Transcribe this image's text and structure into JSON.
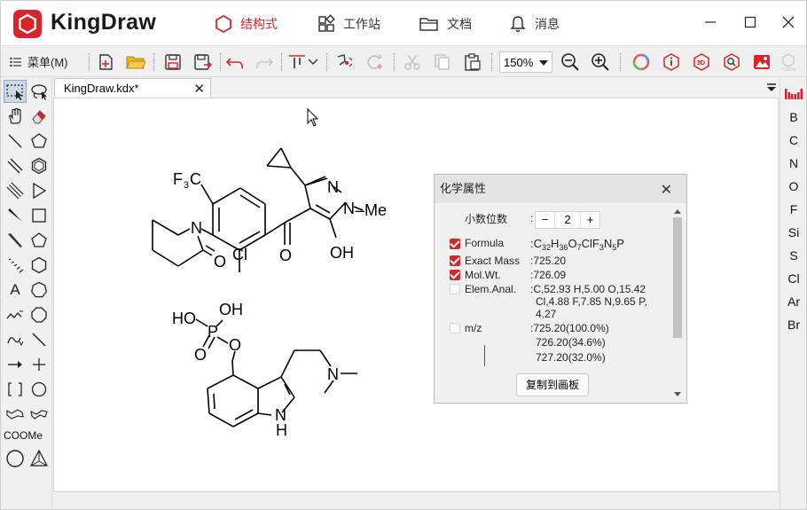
{
  "app": {
    "brand": "KingDraw"
  },
  "nav": {
    "tabs": [
      {
        "label": "结构式",
        "icon": "hexagon-icon",
        "active": true
      },
      {
        "label": "工作站",
        "icon": "grid-icon"
      },
      {
        "label": "文档",
        "icon": "folder-icon"
      },
      {
        "label": "消息",
        "icon": "bell-icon"
      }
    ]
  },
  "toolbar": {
    "menu_label": "菜单(M)",
    "zoom_value": "150%"
  },
  "document": {
    "tab_label": "KingDraw.kdx*"
  },
  "palette": {
    "text_tool": "A",
    "coome_label": "COOMe"
  },
  "elements": [
    "B",
    "C",
    "N",
    "O",
    "F",
    "Si",
    "S",
    "Cl",
    "Ar",
    "Br"
  ],
  "canvas": {
    "mol1": {
      "cf3_f": "F",
      "cf3_3": "3",
      "cf3_c": "C",
      "n_ring": "N",
      "o_ketone_ring": "O",
      "cl": "Cl",
      "o_carbonyl": "O",
      "pyr_n1": "N",
      "pyr_n2": "N",
      "methyl": "–Me",
      "oh": "OH"
    },
    "mol2": {
      "ho": "HO",
      "oh": "OH",
      "p": "P",
      "o_double": "O",
      "o_ester": "O",
      "n_amine": "N",
      "nh_n": "N",
      "nh_h": "H"
    }
  },
  "dialog": {
    "title": "化学属性",
    "decimal_label": "小数位数",
    "decimal_value": "2",
    "minus": "−",
    "plus": "+",
    "copy_button": "复制到画板",
    "properties": [
      {
        "label": "Formula",
        "checked": true
      },
      {
        "label": "Exact Mass",
        "checked": true,
        "value": "725.20"
      },
      {
        "label": "Mol.Wt.",
        "checked": true,
        "value": "726.09"
      },
      {
        "label": "Elem.Anal.",
        "checked": false,
        "value_lines": [
          "C,52.93 H,5.00 O,15.42",
          "Cl,4.88 F,7.85 N,9.65 P,",
          "4.27"
        ]
      },
      {
        "label": "m/z",
        "checked": false,
        "value_lines": [
          "725.20(100.0%)",
          "726.20(34.6%)",
          "727.20(32.0%)"
        ]
      }
    ],
    "formula": {
      "c": "C",
      "c_n": "32",
      "h": "H",
      "h_n": "36",
      "o": "O",
      "o_n": "7",
      "cl": "Cl",
      "f": "F",
      "f_n": "3",
      "n": "N",
      "n_n": "5",
      "p": "P"
    }
  }
}
